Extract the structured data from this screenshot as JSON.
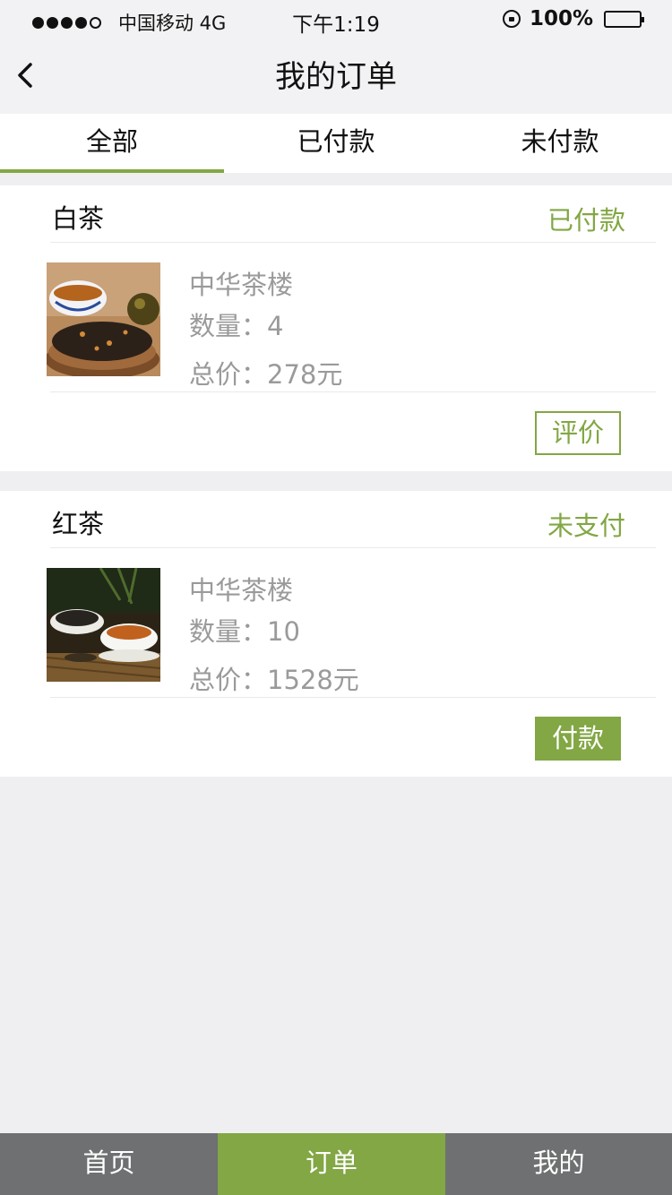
{
  "status_bar": {
    "carrier": "中国移动 4G",
    "time": "下午1:19",
    "battery": "100%"
  },
  "nav": {
    "title": "我的订单"
  },
  "tabs": [
    {
      "label": "全部",
      "active": true
    },
    {
      "label": "已付款",
      "active": false
    },
    {
      "label": "未付款",
      "active": false
    }
  ],
  "orders": [
    {
      "tea_name": "白茶",
      "status": "已付款",
      "shop": "中华茶楼",
      "quantity": "数量：4",
      "total": "总价：278元",
      "action_label": "评价"
    },
    {
      "tea_name": "红茶",
      "status": "未支付",
      "shop": "中华茶楼",
      "quantity": "数量：10",
      "total": "总价：1528元",
      "action_label": "付款"
    }
  ],
  "bottom_nav": [
    {
      "label": "首页",
      "active": false
    },
    {
      "label": "订单",
      "active": true
    },
    {
      "label": "我的",
      "active": false
    }
  ],
  "colors": {
    "accent": "#82a744",
    "background": "#efeff1",
    "bottom_bar": "#6f7071",
    "muted_text": "#9a9a9a"
  }
}
